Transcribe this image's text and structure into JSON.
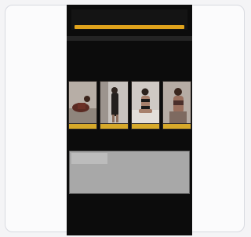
{
  "notice": {
    "text": "",
    "button_label": ""
  },
  "profile_section": {
    "title": "",
    "line1": "",
    "line2": "",
    "line3": "",
    "line4": ""
  },
  "gallery_section": {
    "title": "",
    "photos": [
      {
        "caption": "",
        "pose": "reclining"
      },
      {
        "caption": "",
        "pose": "standing-mirror"
      },
      {
        "caption": "",
        "pose": "seated-bed"
      },
      {
        "caption": "",
        "pose": "portrait"
      }
    ]
  },
  "message_section": {
    "title": "",
    "textarea_value": "",
    "footer_note": ""
  },
  "links_section": {
    "title": "",
    "link1": ""
  },
  "colors": {
    "page_background": "#0c0c0c",
    "accent": "#e0a31c",
    "section_header": "#242424"
  }
}
